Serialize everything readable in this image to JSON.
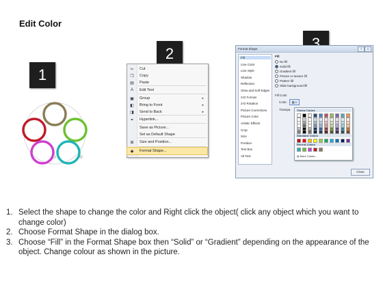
{
  "title": "Edit Color",
  "step_numbers": [
    "1",
    "2",
    "3"
  ],
  "colors": {
    "ring_olive": "#8a7d55",
    "ring_red": "#c01a2a",
    "ring_green": "#6cc230",
    "ring_magenta": "#cf3fd0",
    "ring_cyan": "#1fb5b7",
    "number_box": "#1e1e1e",
    "menu_highlight": "#fbe7a6",
    "dialog_bg": "#ecf0f6"
  },
  "context_menu": {
    "items": [
      {
        "label": "Cut",
        "icon": "scissors-icon",
        "glyph": "✂",
        "arrow": ""
      },
      {
        "label": "Copy",
        "icon": "copy-icon",
        "glyph": "❐",
        "arrow": ""
      },
      {
        "label": "Paste",
        "icon": "paste-icon",
        "glyph": "▤",
        "arrow": ""
      },
      {
        "label": "Edit Text",
        "icon": "edit-text-icon",
        "glyph": "A",
        "arrow": ""
      },
      {
        "label": "Group",
        "icon": "group-icon",
        "glyph": "▣",
        "arrow": "▸"
      },
      {
        "label": "Bring to Front",
        "icon": "bring-front-icon",
        "glyph": "◧",
        "arrow": "▸"
      },
      {
        "label": "Send to Back",
        "icon": "send-back-icon",
        "glyph": "◨",
        "arrow": "▸"
      },
      {
        "label": "Hyperlink...",
        "icon": "hyperlink-icon",
        "glyph": "⚭",
        "arrow": ""
      },
      {
        "label": "Save as Picture...",
        "icon": "",
        "glyph": "",
        "arrow": ""
      },
      {
        "label": "Set as Default Shape",
        "icon": "",
        "glyph": "",
        "arrow": ""
      },
      {
        "label": "Size and Position...",
        "icon": "size-icon",
        "glyph": "⊞",
        "arrow": ""
      },
      {
        "label": "Format Shape...",
        "icon": "format-shape-icon",
        "glyph": "◆",
        "arrow": ""
      }
    ]
  },
  "dialog": {
    "title": "Format Shape",
    "title_buttons": [
      "?",
      "x"
    ],
    "categories": [
      "Fill",
      "Line Color",
      "Line Style",
      "Shadow",
      "Reflection",
      "Glow and Soft Edges",
      "3-D Format",
      "3-D Rotation",
      "Picture Corrections",
      "Picture Color",
      "Artistic Effects",
      "Crop",
      "Size",
      "Position",
      "Text Box",
      "Alt Text"
    ],
    "fill_heading": "Fill",
    "fill_options": [
      {
        "label": "No fill",
        "selected": false
      },
      {
        "label": "Solid fill",
        "selected": true
      },
      {
        "label": "Gradient fill",
        "selected": false
      },
      {
        "label": "Picture or texture fill",
        "selected": false
      },
      {
        "label": "Pattern fill",
        "selected": false
      },
      {
        "label": "Slide background fill",
        "selected": false
      }
    ],
    "fill_color_label": "Fill Color",
    "color_label": "Color:",
    "transparency_label": "Transpa",
    "palette": {
      "theme_heading": "Theme Colors",
      "standard_heading": "Standard Colors",
      "recent_heading": "Recent Colors",
      "more_colors": "More Colors...",
      "theme_top": [
        "#ffffff",
        "#000000",
        "#eeece1",
        "#1f497d",
        "#4f81bd",
        "#c0504d",
        "#9bbb59",
        "#8064a2",
        "#4bacc6",
        "#f79646"
      ],
      "standard": [
        "#c00000",
        "#ff0000",
        "#ffc000",
        "#ffff00",
        "#92d050",
        "#00b050",
        "#00b0f0",
        "#0070c0",
        "#002060",
        "#7030a0"
      ],
      "recent": [
        "#1fb5b7",
        "#6cc230",
        "#cf3fd0",
        "#c01a2a",
        "#8a7d55"
      ]
    },
    "close_label": "Close"
  },
  "instructions": [
    {
      "num": "1.",
      "text": "Select the shape to change the color and Right click the object( click any object which you want to change color)"
    },
    {
      "num": "2.",
      "text": "Choose Format Shape in the dialog box."
    },
    {
      "num": "3.",
      "text": "Choose “Fill” in the Format Shape box then “Solid” or “Gradient” depending on the appearance of the object. Change colour as shown in the picture."
    }
  ]
}
